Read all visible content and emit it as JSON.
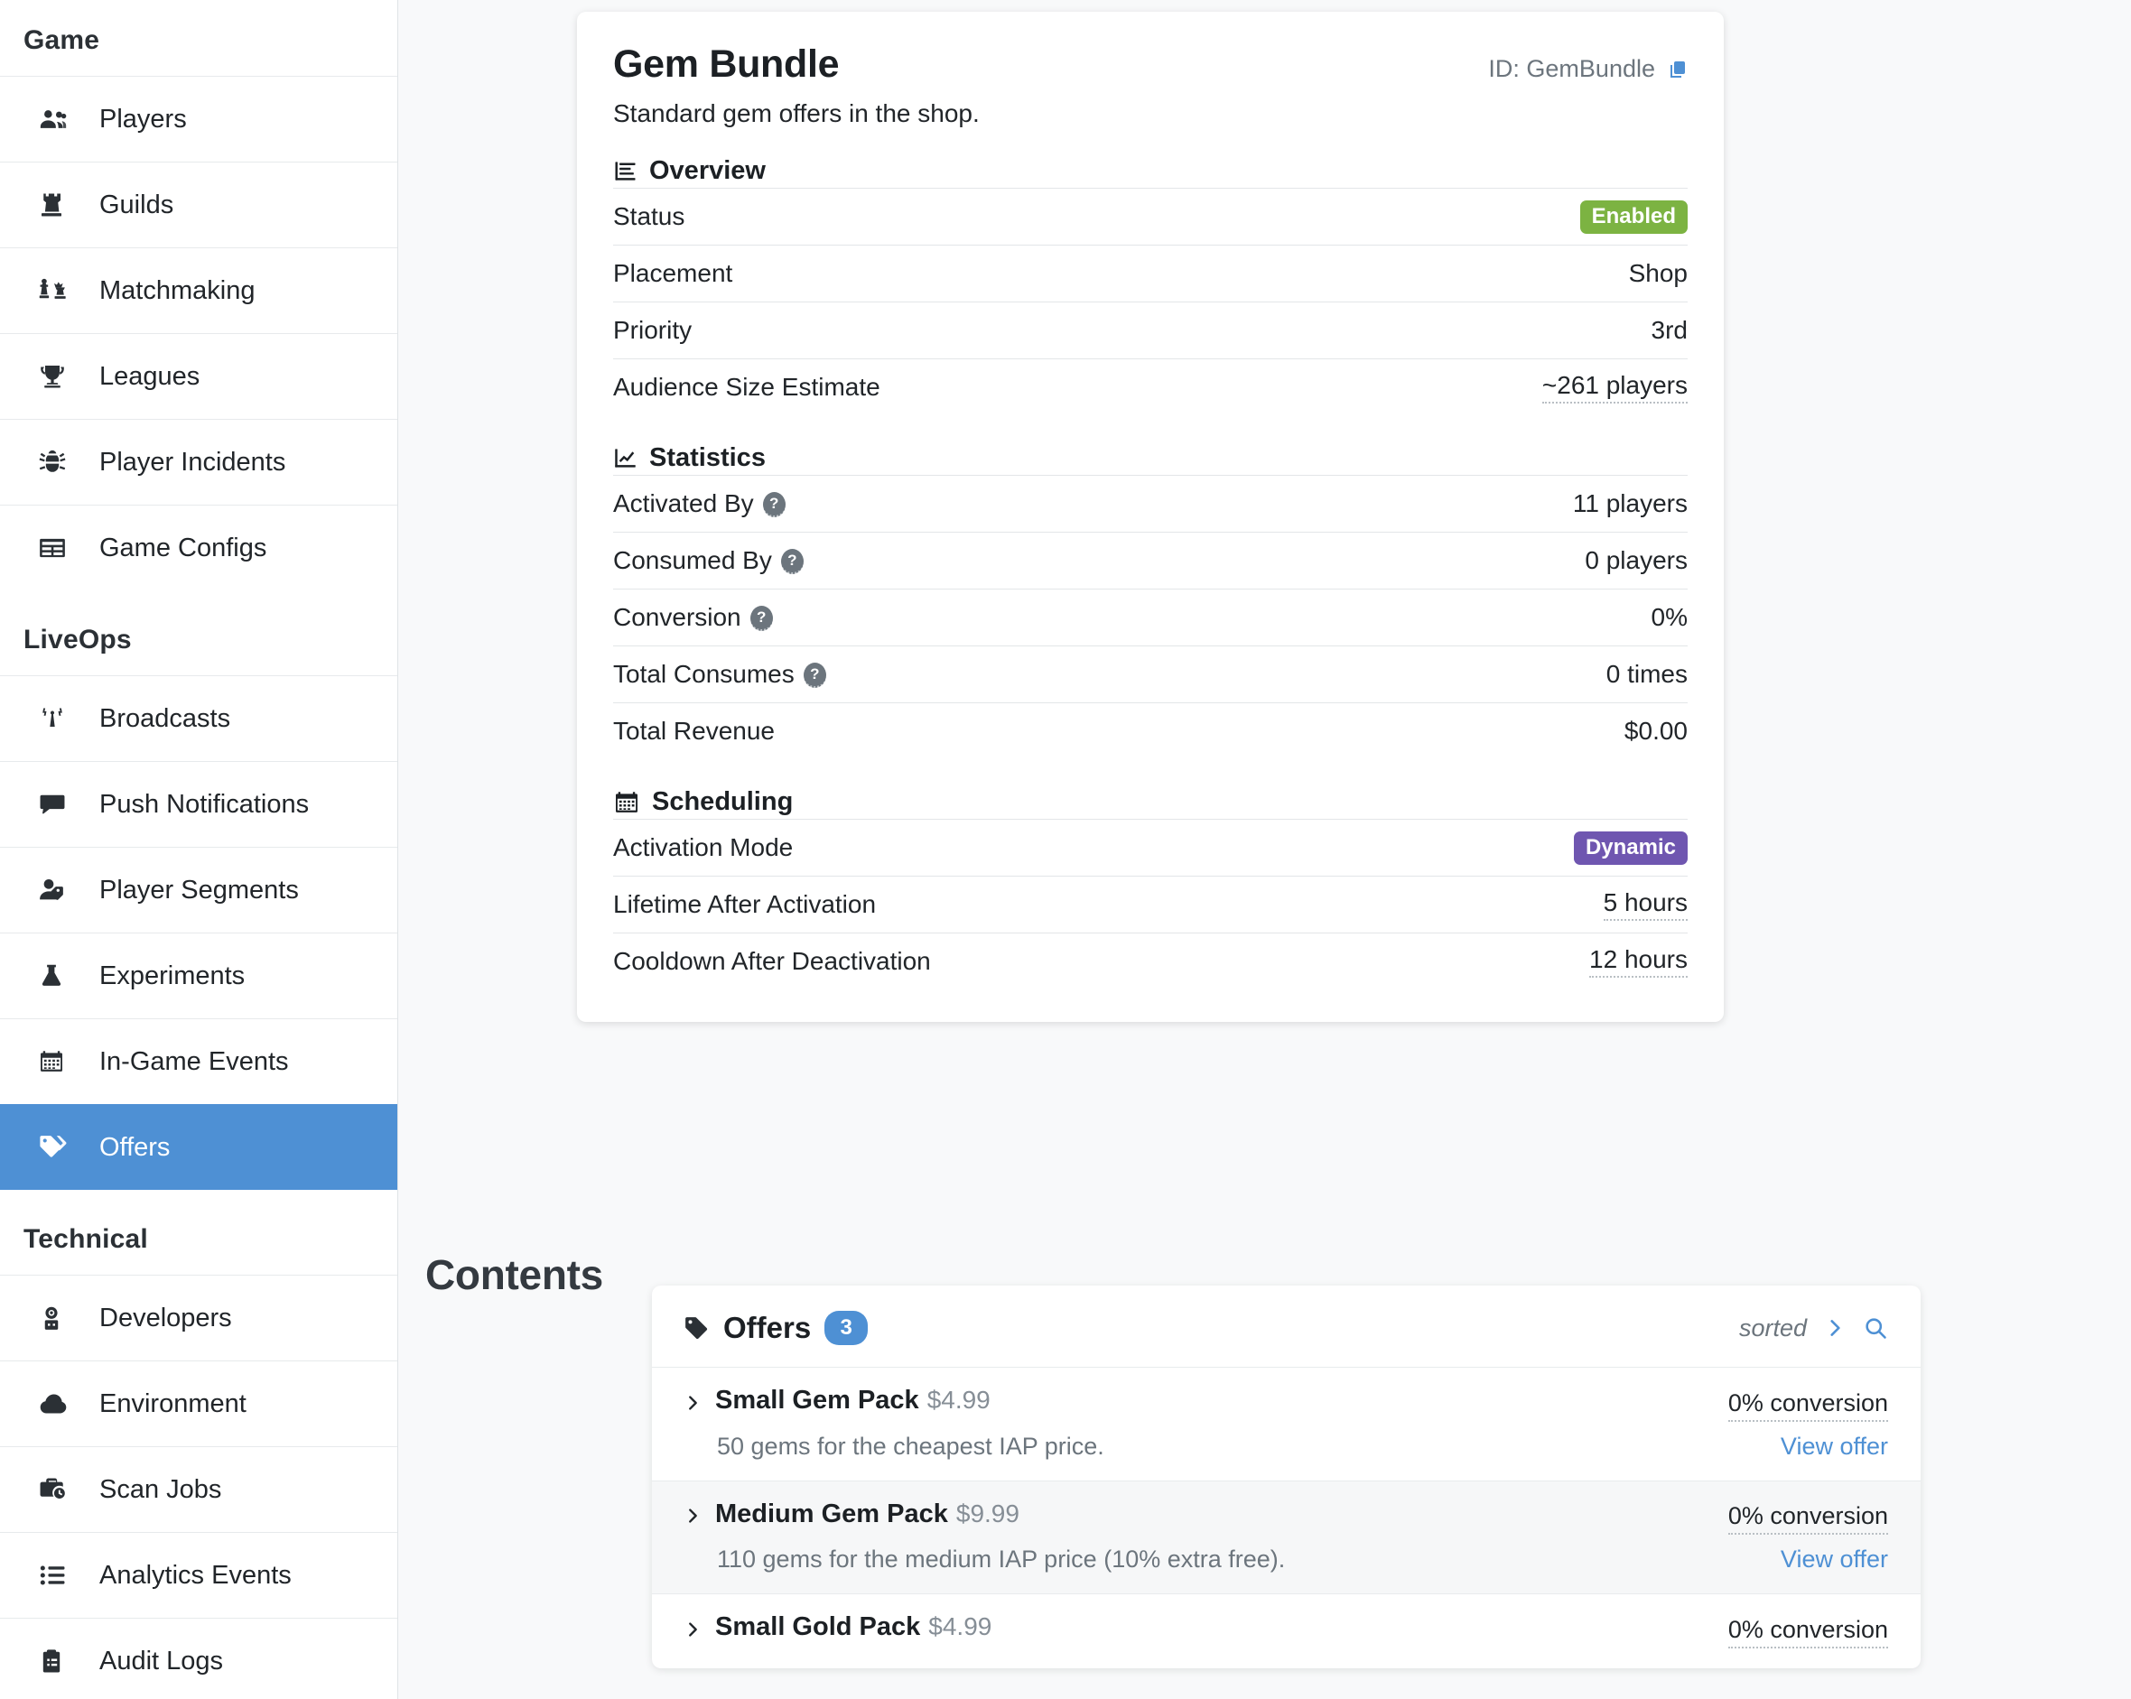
{
  "sidebar": {
    "groups": [
      {
        "title": "Game",
        "items": [
          {
            "label": "Players",
            "icon": "players-icon",
            "active": false
          },
          {
            "label": "Guilds",
            "icon": "guilds-rook-icon",
            "active": false
          },
          {
            "label": "Matchmaking",
            "icon": "matchmaking-chess-icon",
            "active": false
          },
          {
            "label": "Leagues",
            "icon": "trophy-icon",
            "active": false
          },
          {
            "label": "Player Incidents",
            "icon": "bug-icon",
            "active": false
          },
          {
            "label": "Game Configs",
            "icon": "table-icon",
            "active": false
          }
        ]
      },
      {
        "title": "LiveOps",
        "items": [
          {
            "label": "Broadcasts",
            "icon": "broadcast-antenna-icon",
            "active": false
          },
          {
            "label": "Push Notifications",
            "icon": "chat-bubble-icon",
            "active": false
          },
          {
            "label": "Player Segments",
            "icon": "person-tag-icon",
            "active": false
          },
          {
            "label": "Experiments",
            "icon": "flask-icon",
            "active": false
          },
          {
            "label": "In-Game Events",
            "icon": "calendar-icon",
            "active": false
          },
          {
            "label": "Offers",
            "icon": "tag-icon",
            "active": true
          }
        ]
      },
      {
        "title": "Technical",
        "items": [
          {
            "label": "Developers",
            "icon": "developer-person-icon",
            "active": false
          },
          {
            "label": "Environment",
            "icon": "cloud-icon",
            "active": false
          },
          {
            "label": "Scan Jobs",
            "icon": "briefcase-clock-icon",
            "active": false
          },
          {
            "label": "Analytics Events",
            "icon": "list-icon",
            "active": false
          },
          {
            "label": "Audit Logs",
            "icon": "clipboard-icon",
            "active": false
          }
        ]
      }
    ]
  },
  "detail": {
    "title": "Gem Bundle",
    "id_label": "ID: GemBundle",
    "copy_icon": "copy-icon",
    "description": "Standard gem offers in the shop.",
    "sections": [
      {
        "heading": "Overview",
        "icon": "overview-bars-icon",
        "rows": [
          {
            "key": "Status",
            "value": "Enabled",
            "kind": "badge",
            "badge_color": "green",
            "help": false,
            "dotted": false
          },
          {
            "key": "Placement",
            "value": "Shop",
            "kind": "text",
            "help": false,
            "dotted": false
          },
          {
            "key": "Priority",
            "value": "3rd",
            "kind": "text",
            "help": false,
            "dotted": false
          },
          {
            "key": "Audience Size Estimate",
            "value": "~261 players",
            "kind": "text",
            "help": false,
            "dotted": true
          }
        ]
      },
      {
        "heading": "Statistics",
        "icon": "statistics-chart-icon",
        "rows": [
          {
            "key": "Activated By",
            "value": "11 players",
            "kind": "text",
            "help": true,
            "dotted": false
          },
          {
            "key": "Consumed By",
            "value": "0 players",
            "kind": "text",
            "help": true,
            "dotted": false
          },
          {
            "key": "Conversion",
            "value": "0%",
            "kind": "text",
            "help": true,
            "dotted": false
          },
          {
            "key": "Total Consumes",
            "value": "0 times",
            "kind": "text",
            "help": true,
            "dotted": false
          },
          {
            "key": "Total Revenue",
            "value": "$0.00",
            "kind": "text",
            "help": false,
            "dotted": false
          }
        ]
      },
      {
        "heading": "Scheduling",
        "icon": "calendar-icon",
        "rows": [
          {
            "key": "Activation Mode",
            "value": "Dynamic",
            "kind": "badge",
            "badge_color": "purple",
            "help": false,
            "dotted": false
          },
          {
            "key": "Lifetime After Activation",
            "value": "5 hours",
            "kind": "text",
            "help": false,
            "dotted": true
          },
          {
            "key": "Cooldown After Deactivation",
            "value": "12 hours",
            "kind": "text",
            "help": false,
            "dotted": true
          }
        ]
      }
    ],
    "help_glyph": "?"
  },
  "contents": {
    "title": "Contents",
    "offers_panel": {
      "tag_icon": "tag-icon",
      "title": "Offers",
      "count": "3",
      "sorted_label": "sorted",
      "chevron_icon": "chevron-right-icon",
      "search_icon": "search-icon",
      "rows": [
        {
          "chevron_icon": "chevron-right-icon",
          "name": "Small Gem Pack",
          "price": "$4.99",
          "conversion": "0% conversion",
          "description": "50 gems for the cheapest IAP price.",
          "link": "View offer"
        },
        {
          "chevron_icon": "chevron-right-icon",
          "name": "Medium Gem Pack",
          "price": "$9.99",
          "conversion": "0% conversion",
          "description": "110 gems for the medium IAP price (10% extra free).",
          "link": "View offer"
        },
        {
          "chevron_icon": "chevron-right-icon",
          "name": "Small Gold Pack",
          "price": "$4.99",
          "conversion": "0% conversion",
          "description": "",
          "link": ""
        }
      ]
    }
  },
  "colors": {
    "accent_blue": "#4e90d4",
    "status_green": "#7cb342",
    "badge_purple": "#6f56b0",
    "page_bg": "#f8f9fa"
  }
}
